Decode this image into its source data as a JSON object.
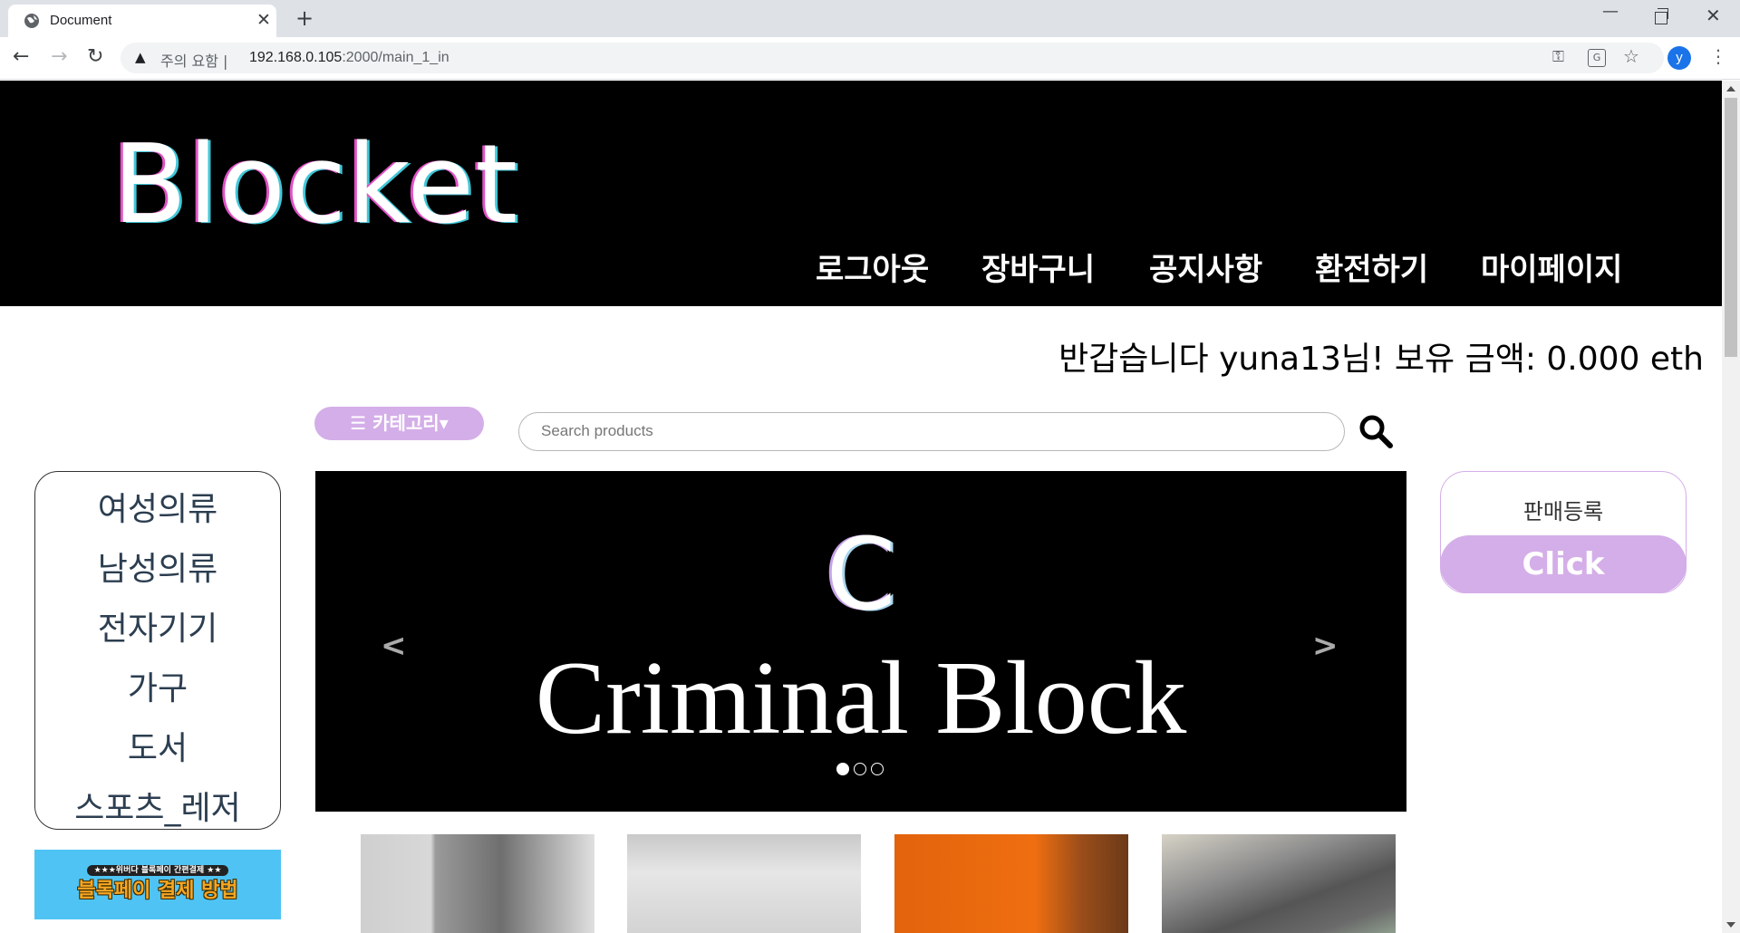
{
  "browser": {
    "tab_title": "Document",
    "tab_close": "✕",
    "new_tab": "+",
    "security_warning": "주의 요함",
    "url_host": "192.168.0.105",
    "url_path": ":2000/main_1_in",
    "profile_initial": "y"
  },
  "site": {
    "logo": "Blocket",
    "nav": [
      "로그아웃",
      "장바구니",
      "공지사항",
      "환전하기",
      "마이페이지"
    ],
    "greeting": "반갑습니다 yuna13님! 보유 금액: 0.000 eth",
    "category_button": "☰ 카테고리▾",
    "search_placeholder": "Search products",
    "categories": [
      "여성의류",
      "남성의류",
      "전자기기",
      "가구",
      "도서",
      "스포츠_레저"
    ],
    "pay_banner": {
      "badge": "★★★위버다 블록페이 간편결제 ★★",
      "title": "블록페이 결제 방법"
    },
    "carousel": {
      "letter": "C",
      "title": "Criminal Block",
      "slide_count": 3,
      "active_slide": 1
    },
    "sell": {
      "label": "판매등록",
      "button": "Click"
    }
  },
  "colors": {
    "accent": "#d4aee8",
    "header_bg": "#000000",
    "banner_bg": "#4fc4f4"
  }
}
